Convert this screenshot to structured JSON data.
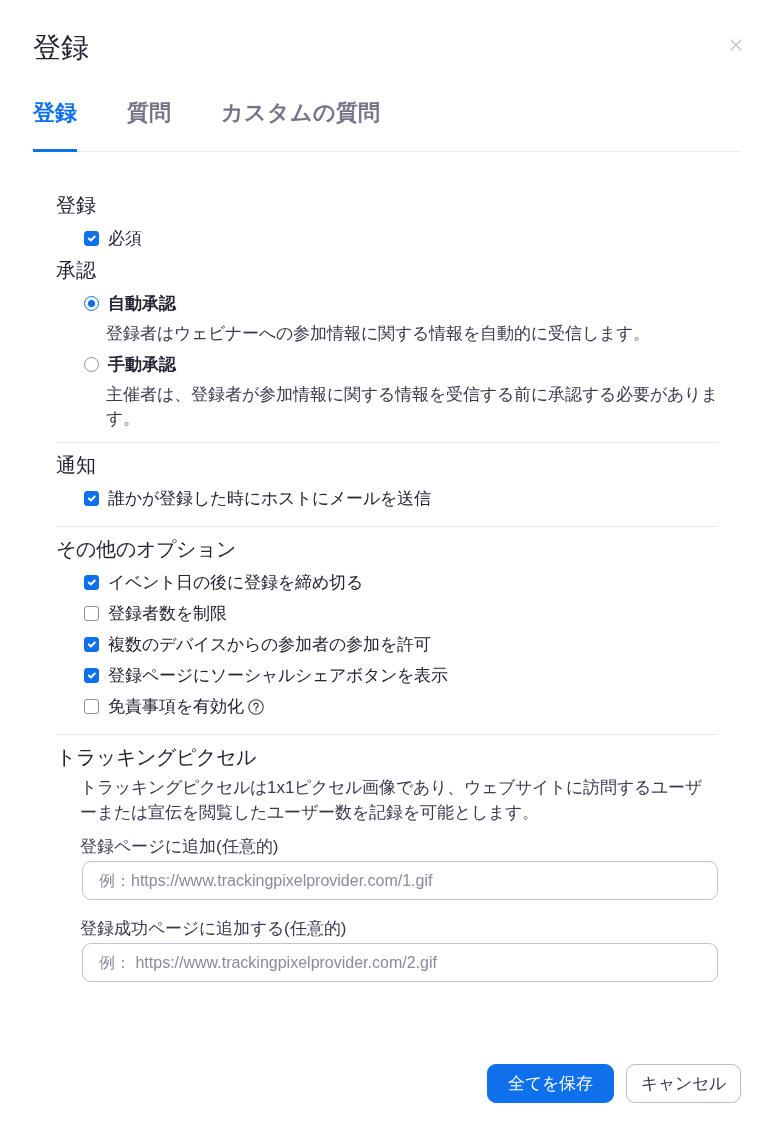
{
  "dialog": {
    "title": "登録"
  },
  "tabs": [
    {
      "label": "登録",
      "selected": true
    },
    {
      "label": "質問",
      "selected": false
    },
    {
      "label": "カスタムの質問",
      "selected": false
    }
  ],
  "groups": [
    {
      "sections": [
        {
          "heading": "登録",
          "items": [
            {
              "kind": "checkbox",
              "label": "必須",
              "checked": true
            }
          ]
        },
        {
          "heading": "承認",
          "items": [
            {
              "kind": "radio",
              "label": "自動承認",
              "selected": true,
              "description": "登録者はウェビナーへの参加情報に関する情報を自動的に受信します。"
            },
            {
              "kind": "radio",
              "label": "手動承認",
              "selected": false,
              "description": "主催者は、登録者が参加情報に関する情報を受信する前に承認する必要があります。"
            }
          ]
        }
      ]
    },
    {
      "sections": [
        {
          "heading": "通知",
          "items": [
            {
              "kind": "checkbox",
              "label": "誰かが登録した時にホストにメールを送信",
              "checked": true
            }
          ]
        }
      ]
    },
    {
      "sections": [
        {
          "heading": "その他のオプション",
          "items": [
            {
              "kind": "checkbox",
              "label": "イベント日の後に登録を締め切る",
              "checked": true
            },
            {
              "kind": "checkbox",
              "label": "登録者数を制限",
              "checked": false
            },
            {
              "kind": "checkbox",
              "label": "複数のデバイスからの参加者の参加を許可",
              "checked": true
            },
            {
              "kind": "checkbox",
              "label": "登録ページにソーシャルシェアボタンを表示",
              "checked": true
            },
            {
              "kind": "checkbox",
              "label": "免責事項を有効化",
              "checked": false,
              "help": true
            }
          ]
        }
      ]
    },
    {
      "sections": [
        {
          "heading": "トラッキングピクセル",
          "description": "トラッキングピクセルは1x1ピクセル画像であり、ウェブサイトに訪問するユーザーまたは宣伝を閲覧したユーザー数を記録を可能とします。",
          "fields": [
            {
              "label": "登録ページに追加(任意的)",
              "placeholder": "例：https://www.trackingpixelprovider.com/1.gif"
            },
            {
              "label": "登録成功ページに追加する(任意的)",
              "placeholder": "例： https://www.trackingpixelprovider.com/2.gif"
            }
          ]
        }
      ]
    }
  ],
  "buttons": [
    {
      "kind": "primary",
      "label": "全てを保存"
    },
    {
      "kind": "secondary",
      "label": "キャンセル"
    }
  ]
}
